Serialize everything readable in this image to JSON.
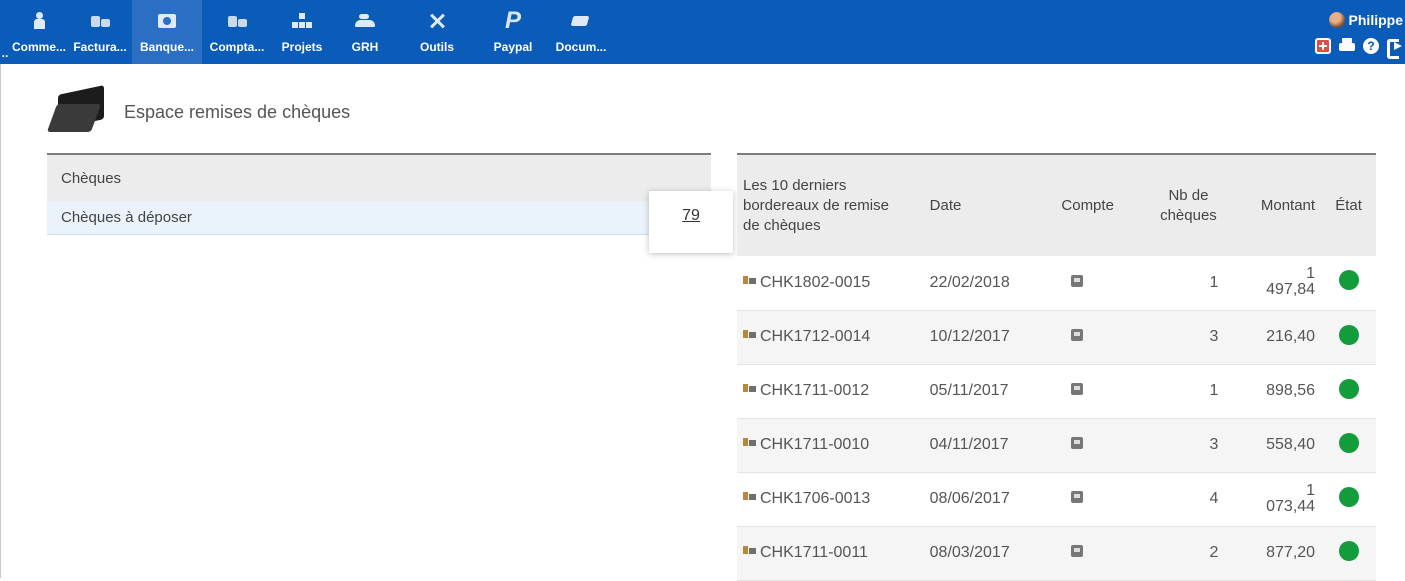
{
  "menu": [
    {
      "label": "Comme...",
      "icon": "person-icon"
    },
    {
      "label": "Factura...",
      "icon": "coins-icon"
    },
    {
      "label": "Banque...",
      "icon": "bank-icon",
      "active": true
    },
    {
      "label": "Compta...",
      "icon": "coins-icon"
    },
    {
      "label": "Projets",
      "icon": "tree-icon"
    },
    {
      "label": "GRH",
      "icon": "hr-icon"
    },
    {
      "label": "Outils",
      "icon": "tools-icon"
    },
    {
      "label": "Paypal",
      "icon": "paypal-icon",
      "glyph": "P"
    },
    {
      "label": "Docum...",
      "icon": "documents-icon"
    }
  ],
  "menu_prefix": "..",
  "user": {
    "name": "Philippe"
  },
  "help_glyph": "?",
  "page": {
    "title": "Espace remises de chèques"
  },
  "left_panel": {
    "header": "Chèques",
    "row_label": "Chèques à déposer",
    "row_count": "79"
  },
  "table": {
    "headers": {
      "ref": "Les 10 derniers bordereaux de remise de chèques",
      "date": "Date",
      "account": "Compte",
      "nb": "Nb de chèques",
      "amount": "Montant",
      "state": "État"
    },
    "rows": [
      {
        "ref": "CHK1802-0015",
        "date": "22/02/2018",
        "nb": "1",
        "amount": "1 497,84",
        "state": "validated"
      },
      {
        "ref": "CHK1712-0014",
        "date": "10/12/2017",
        "nb": "3",
        "amount": "216,40",
        "state": "validated"
      },
      {
        "ref": "CHK1711-0012",
        "date": "05/11/2017",
        "nb": "1",
        "amount": "898,56",
        "state": "validated"
      },
      {
        "ref": "CHK1711-0010",
        "date": "04/11/2017",
        "nb": "3",
        "amount": "558,40",
        "state": "validated"
      },
      {
        "ref": "CHK1706-0013",
        "date": "08/06/2017",
        "nb": "4",
        "amount": "1 073,44",
        "state": "validated"
      },
      {
        "ref": "CHK1711-0011",
        "date": "08/03/2017",
        "nb": "2",
        "amount": "877,20",
        "state": "validated"
      }
    ]
  },
  "colors": {
    "topbar": "#0b5bb8",
    "active_menu": "#2a6fc4",
    "status_ok": "#139b3c"
  }
}
